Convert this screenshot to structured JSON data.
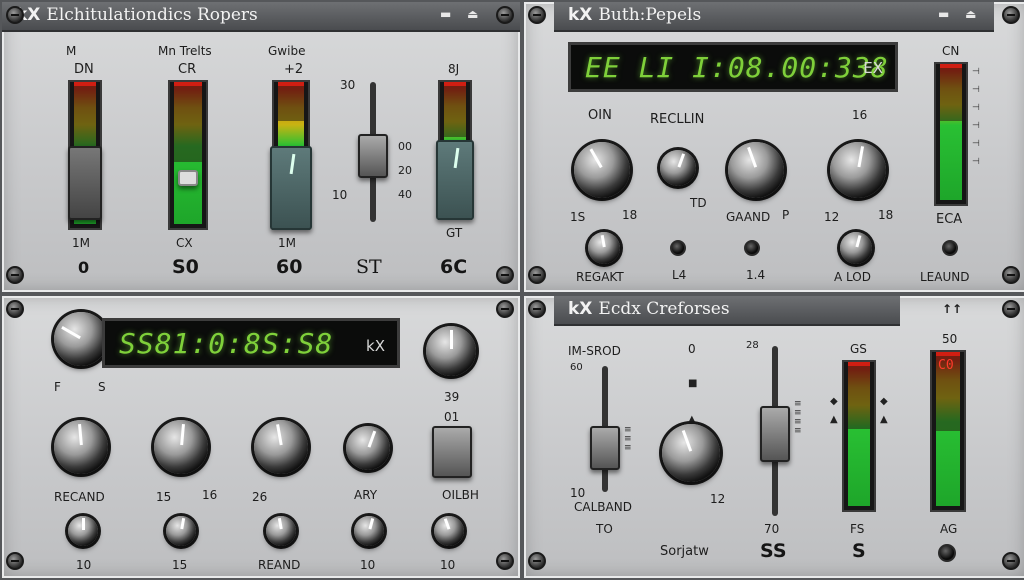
{
  "panel_tl": {
    "title_logo": "kX",
    "title": "Elchitulationdics Ropers",
    "win_icons": "▬ ⏏",
    "channels": [
      {
        "head1": "M",
        "head2": "DN",
        "low": "1M",
        "value": "0",
        "level": 0.55
      },
      {
        "head1": "Mn Trelts",
        "head2": "CR",
        "low": "CX",
        "value": "S0",
        "level": 0.45
      },
      {
        "head1": "Gwibe",
        "head2": "+2",
        "low": "1M",
        "value": "60",
        "level": 0.75
      },
      {
        "head1": "",
        "head2": "",
        "low": "",
        "value": "ST",
        "level": 0.0
      },
      {
        "head1": "",
        "head2": "8J",
        "low": "GT",
        "value": "6C",
        "level": 0.6
      }
    ],
    "fader_scale": {
      "top": "30",
      "s1": "00",
      "s2": "20",
      "s3": "40",
      "left": "10"
    }
  },
  "panel_tr": {
    "title_logo": "kX",
    "title": "Buth:Pepels",
    "win_icons": "▬ ⏏",
    "lcd_value": "EE LI I:08.00:338",
    "lcd_unit": "EX",
    "labels": {
      "oin": "OIN",
      "recllin": "RECLLIN",
      "top16": "16",
      "cn": "CN",
      "k1a": "1S",
      "k1b": "18",
      "k3": "GAAND",
      "k3b": "P",
      "k4a": "12",
      "k4b": "18",
      "td": "TD",
      "eca": "ECA",
      "regakt": "REGAKT",
      "l4": "L4",
      "m4": "1.4",
      "alod": "A LOD",
      "leaund": "LEAUND"
    },
    "meter_level": 0.6
  },
  "panel_bl": {
    "lcd_value": "SS81:0:8S:S8",
    "lcd_unit": "kX",
    "labels": {
      "f": "F",
      "s": "S",
      "v39": "39",
      "v01": "01",
      "recand": "RECAND",
      "v15": "15",
      "v16": "16",
      "v26": "26",
      "ary": "ARY",
      "oilbh": "OILBH",
      "v10a": "10",
      "v15b": "15",
      "reand": "REAND",
      "v10b": "10",
      "v10c": "10"
    }
  },
  "panel_br": {
    "title_logo": "kX",
    "title": "Ecdx Creforses",
    "arrows": "↑↑",
    "labels": {
      "imsrod": "IM-SROD",
      "zero": "0",
      "v28": "28",
      "gs": "GS",
      "v50": "50",
      "v60": "60",
      "v10": "10",
      "calband": "CALBAND",
      "v12": "12",
      "to": "TO",
      "v70": "70",
      "fs": "FS",
      "ag": "AG",
      "sorjatw": "Sorjatw",
      "ss": "SS",
      "s": "S"
    },
    "meter_led": "C0",
    "meter1_level": 0.55,
    "meter2_level": 0.5
  }
}
